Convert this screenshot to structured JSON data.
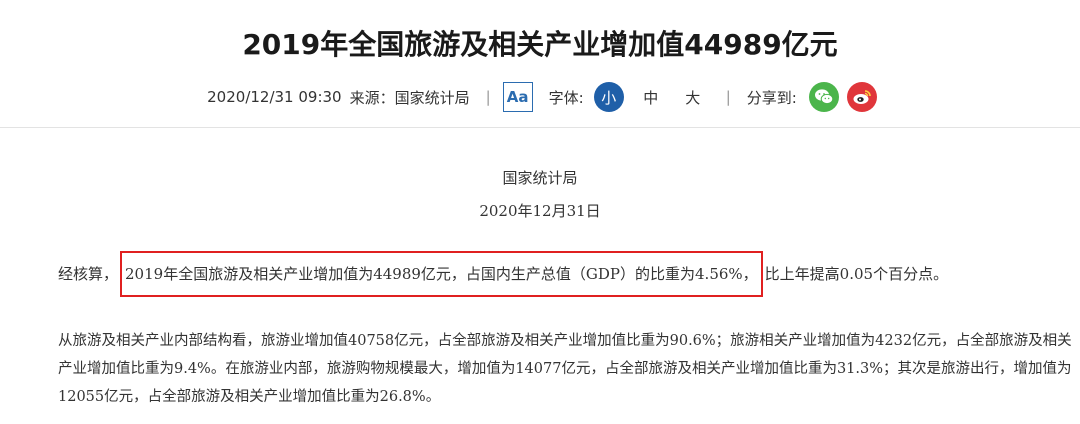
{
  "article": {
    "title": "2019年全国旅游及相关产业增加值44989亿元"
  },
  "meta": {
    "datetime": "2020/12/31 09:30",
    "source": "来源：国家统计局",
    "font_toggle_icon_label": "Aa",
    "font_label": "字体:",
    "font_small": "小",
    "font_medium": "中",
    "font_large": "大",
    "share_label": "分享到:",
    "separator": "|"
  },
  "body": {
    "source_org": "国家统计局",
    "date": "2020年12月31日",
    "p1_lead": "经核算，",
    "p1_highlight": "2019年全国旅游及相关产业增加值为44989亿元，占国内生产总值（GDP）的比重为4.56%，",
    "p1_tail": "比上年提高0.05个百分点。",
    "p2": "从旅游及相关产业内部结构看，旅游业增加值40758亿元，占全部旅游及相关产业增加值比重为90.6%；旅游相关产业增加值为4232亿元，占全部旅游及相关产业增加值比重为9.4%。在旅游业内部，旅游购物规模最大，增加值为14077亿元，占全部旅游及相关产业增加值比重为31.3%；其次是旅游出行，增加值为12055亿元，占全部旅游及相关产业增加值比重为26.8%。"
  },
  "icons": {
    "wechat": "wechat-icon",
    "weibo": "weibo-icon"
  },
  "colors": {
    "accent_blue": "#1f5fa8",
    "wechat_green": "#4bb54b",
    "weibo_red": "#e0363b",
    "highlight_red": "#e02020"
  }
}
